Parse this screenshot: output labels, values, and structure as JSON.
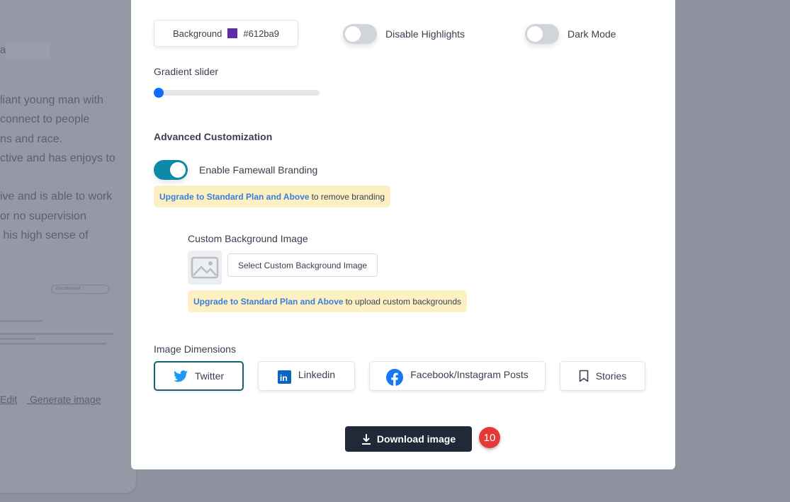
{
  "background_page": {
    "name_prefix": "a",
    "paragraph": "liant young man with\nconnect to people\nns and race.\nctive and has enjoys to\n\nive and is able to work\nor no supervision\n his high sense of",
    "recommend_pill": "Recommend",
    "edit_link": "Edit",
    "generate_link": "Generate image"
  },
  "modal": {
    "background_button": {
      "label": "Background",
      "color": "#612ba9",
      "value": "#612ba9"
    },
    "disable_highlights": {
      "label": "Disable Highlights",
      "on": false
    },
    "dark_mode": {
      "label": "Dark Mode",
      "on": false
    },
    "gradient_slider": {
      "label": "Gradient slider",
      "value_percent": 0
    },
    "advanced_title": "Advanced Customization",
    "branding": {
      "label": "Enable Famewall Branding",
      "on": true
    },
    "branding_notice": {
      "link": "Upgrade to Standard Plan and Above",
      "text": "to remove branding"
    },
    "custom_bg": {
      "label": "Custom Background Image",
      "button": "Select Custom Background Image"
    },
    "custom_bg_notice": {
      "link": "Upgrade to Standard Plan and Above",
      "text": "to upload custom backgrounds"
    },
    "dimensions_title": "Image Dimensions",
    "dimensions": [
      {
        "label": "Twitter",
        "icon": "twitter-icon",
        "selected": true
      },
      {
        "label": "Linkedin",
        "icon": "linkedin-icon",
        "selected": false
      },
      {
        "label": "Facebook/Instagram Posts",
        "icon": "facebook-icon",
        "selected": false
      },
      {
        "label": "Stories",
        "icon": "bookmark-icon",
        "selected": false
      }
    ],
    "download_button": "Download image",
    "step_badge": "10"
  },
  "colors": {
    "accent": "#0e8aa8",
    "link": "#3b7dd8",
    "notice_bg": "#fdf1c4",
    "dark_button": "#1f2937",
    "badge": "#e53935"
  }
}
